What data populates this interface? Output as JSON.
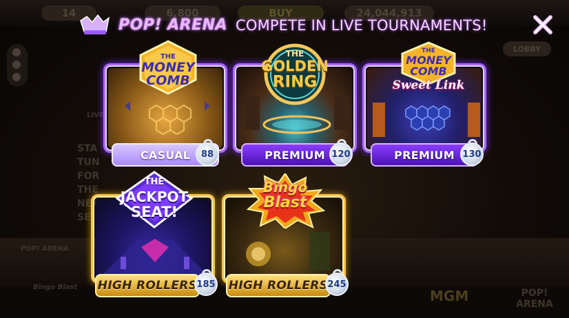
{
  "background": {
    "lobby_value_1": "14",
    "lobby_value_2": "6,800",
    "lobby_buy": "BUY",
    "lobby_balance": "24,044,913",
    "lobby_lobby": "LOBBY",
    "lobby_live": "LIVE",
    "lobby_side_text": "STA TUN FOR THE NEXT SE",
    "footer_pop": "POP! ARENA",
    "footer_mgm": "MGM",
    "footer_bingo": "Bingo Blast"
  },
  "header": {
    "brand": "POP! ARENA",
    "tagline": "COMPETE IN LIVE TOURNAMENTS!",
    "close_icon": "close-icon"
  },
  "colors": {
    "purple_accent": "#a96bff",
    "gold_accent": "#f7c449",
    "brand_glow": "#b84dff"
  },
  "tournaments": [
    {
      "title_line1": "THE",
      "title_line2": "MONEY",
      "title_line3": "COMB",
      "subtitle": "",
      "tier": "CASUAL",
      "level": "88",
      "style": "purple"
    },
    {
      "title_line1": "THE",
      "title_line2": "GOLDEN",
      "title_line3": "RING",
      "subtitle": "",
      "tier": "PREMIUM",
      "level": "120",
      "style": "purple"
    },
    {
      "title_line1": "THE",
      "title_line2": "MONEY",
      "title_line3": "COMB",
      "subtitle": "Sweet Link",
      "tier": "PREMIUM",
      "level": "130",
      "style": "purple"
    },
    {
      "title_line1": "THE",
      "title_line2": "JACKPOT",
      "title_line3": "SEAT!",
      "subtitle": "",
      "tier": "HIGH ROLLERS",
      "level": "185",
      "style": "gold"
    },
    {
      "title_line1": "Bingo",
      "title_line2": "Blast",
      "title_line3": "",
      "subtitle": "",
      "tier": "HIGH ROLLERS",
      "level": "245",
      "style": "gold"
    }
  ]
}
